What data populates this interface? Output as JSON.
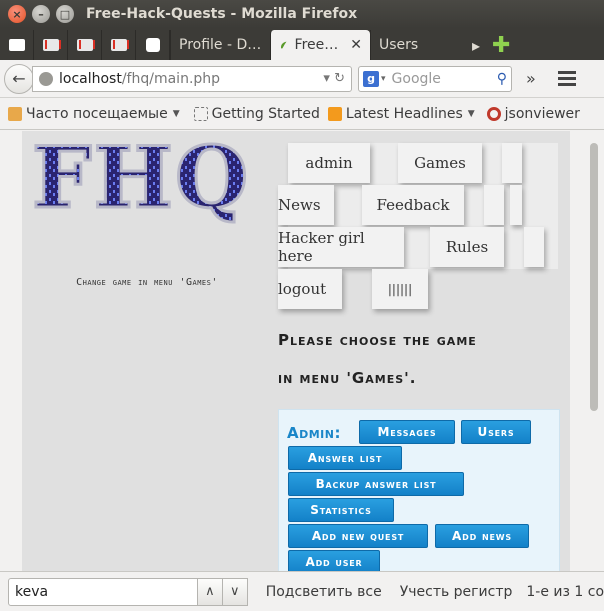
{
  "window": {
    "title": "Free-Hack-Quests - Mozilla Firefox"
  },
  "tabs": [
    {
      "label": "Profile - D…"
    },
    {
      "label": "Free…"
    },
    {
      "label": "Users"
    }
  ],
  "navbar": {
    "url_host": "localhost",
    "url_path": "/fhq/main.php",
    "search_placeholder": "Google"
  },
  "bookmarks": [
    {
      "label": "Часто посещаемые"
    },
    {
      "label": "Getting Started"
    },
    {
      "label": "Latest Headlines"
    },
    {
      "label": "jsonviewer"
    }
  ],
  "page": {
    "logo_text": "FHQ",
    "logo_message": "Change game in menu 'Games'",
    "menu": {
      "admin": "admin",
      "games": "Games",
      "news": "News",
      "feedback": "Feedback",
      "hacker_girl": "Hacker girl here",
      "rules": "Rules",
      "logout": "logout",
      "bars": "||||||"
    },
    "notice_line1": "Please choose the game",
    "notice_line2": "in menu 'Games'.",
    "admin": {
      "label": "Admin:",
      "buttons": {
        "messages": "Messages",
        "users": "Users",
        "answer_list": "Answer list",
        "backup_answer_list": "Backup answer list",
        "statistics": "Statistics",
        "add_new_quest": "Add new quest",
        "add_news": "Add news",
        "add_user": "Add user"
      }
    }
  },
  "findbar": {
    "query": "keva",
    "highlight_all": "Подсветить все",
    "match_case": "Учесть регистр",
    "result": "1-е из 1 со"
  }
}
